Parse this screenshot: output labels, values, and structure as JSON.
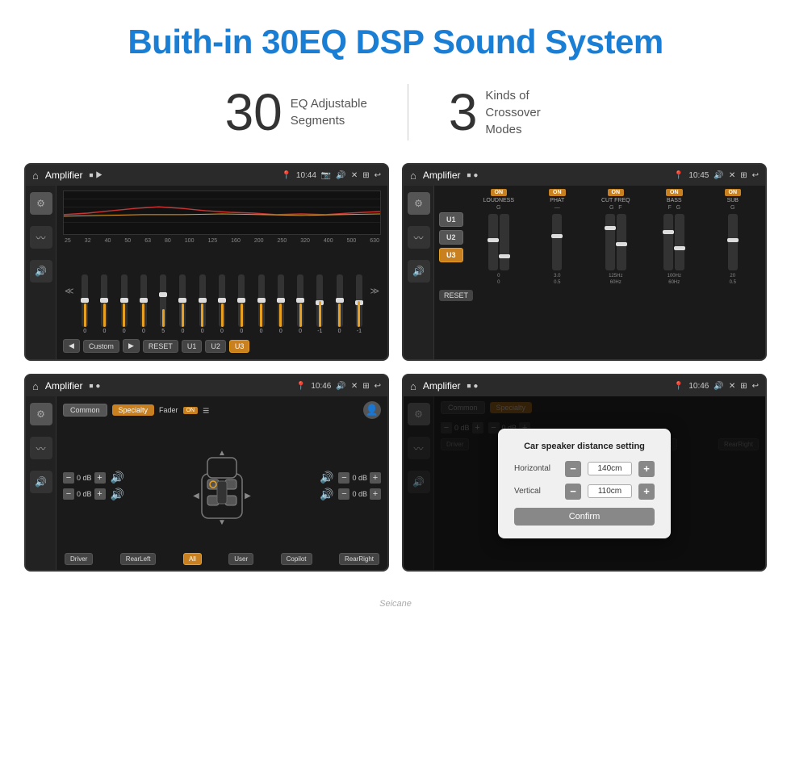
{
  "header": {
    "title": "Buith-in 30EQ DSP Sound System"
  },
  "stats": [
    {
      "number": "30",
      "label": "EQ Adjustable\nSegments"
    },
    {
      "number": "3",
      "label": "Kinds of\nCrossover Modes"
    }
  ],
  "screens": {
    "eq": {
      "header": {
        "home": "⌂",
        "title": "Amplifier",
        "time": "10:44"
      },
      "freq_labels": [
        "25",
        "32",
        "40",
        "50",
        "63",
        "80",
        "100",
        "125",
        "160",
        "200",
        "250",
        "320",
        "400",
        "500",
        "630"
      ],
      "slider_values": [
        "0",
        "0",
        "0",
        "0",
        "5",
        "0",
        "0",
        "0",
        "0",
        "0",
        "0",
        "0",
        "-1",
        "0",
        "-1"
      ],
      "controls": {
        "prev": "◀",
        "label": "Custom",
        "next": "▶",
        "reset": "RESET",
        "u1": "U1",
        "u2": "U2",
        "u3": "U3"
      }
    },
    "crossover": {
      "header": {
        "home": "⌂",
        "title": "Amplifier",
        "time": "10:45"
      },
      "presets": [
        "U1",
        "U2",
        "U3"
      ],
      "active_preset": "U3",
      "bands": [
        {
          "on_label": "ON",
          "name": "LOUDNESS",
          "g_label": ""
        },
        {
          "on_label": "ON",
          "name": "PHAT",
          "g_label": ""
        },
        {
          "on_label": "ON",
          "name": "CUT FREQ",
          "g_label": "G"
        },
        {
          "on_label": "ON",
          "name": "BASS",
          "g_label": "G"
        },
        {
          "on_label": "ON",
          "name": "SUB",
          "g_label": "G"
        }
      ],
      "reset_label": "RESET"
    },
    "speaker": {
      "header": {
        "home": "⌂",
        "title": "Amplifier",
        "time": "10:46"
      },
      "tab_common": "Common",
      "tab_specialty": "Specialty",
      "fader_label": "Fader",
      "fader_on": "ON",
      "db_controls": [
        {
          "value": "0 dB"
        },
        {
          "value": "0 dB"
        },
        {
          "value": "0 dB"
        },
        {
          "value": "0 dB"
        }
      ],
      "zone_buttons": [
        "Driver",
        "RearLeft",
        "All",
        "User",
        "Copilot",
        "RearRight"
      ]
    },
    "distance": {
      "header": {
        "home": "⌂",
        "title": "Amplifier",
        "time": "10:46"
      },
      "dialog": {
        "title": "Car speaker distance setting",
        "rows": [
          {
            "label": "Horizontal",
            "value": "140cm"
          },
          {
            "label": "Vertical",
            "value": "110cm"
          }
        ],
        "confirm_label": "Confirm"
      }
    }
  },
  "watermark": "Seicane"
}
